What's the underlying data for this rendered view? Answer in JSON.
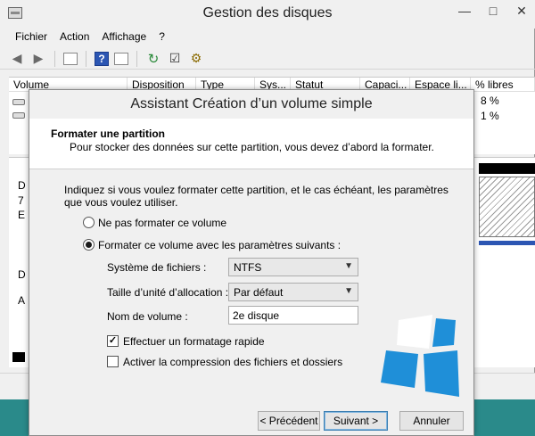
{
  "bg": {
    "title": "Gestion des disques",
    "menu": [
      "Fichier",
      "Action",
      "Affichage",
      "?"
    ],
    "columns": [
      "Volume",
      "Disposition",
      "Type",
      "Sys...",
      "Statut",
      "Capaci...",
      "Espace li...",
      "% libres"
    ],
    "pct_row1": "8 %",
    "pct_row2": "1 %",
    "left_letters": [
      "D",
      "7",
      "E",
      "D",
      "A"
    ]
  },
  "wizard": {
    "title": "Assistant Création d’un volume simple",
    "header_title": "Formater une partition",
    "header_subtitle": "Pour stocker des données sur cette partition, vous devez d’abord la formater.",
    "intro": "Indiquez si vous voulez formater cette partition, et le cas échéant, les paramètres que vous voulez utiliser.",
    "option_no_format": "Ne pas formater ce volume",
    "option_format": "Formater ce volume avec les paramètres suivants :",
    "option_selected": "format",
    "fs_label": "Système de fichiers :",
    "fs_value": "NTFS",
    "alloc_label": "Taille d’unité d’allocation :",
    "alloc_value": "Par défaut",
    "volname_label": "Nom de volume :",
    "volname_value": "2e disque",
    "quick_format_label": "Effectuer un formatage rapide",
    "quick_format_checked": true,
    "compression_label": "Activer la compression des fichiers et dossiers",
    "compression_checked": false,
    "btn_prev": "< Précédent",
    "btn_next": "Suivant >",
    "btn_cancel": "Annuler"
  },
  "colors": {
    "accent": "#2c56b3",
    "watermark_blue": "#1f8fd8",
    "taskbar": "#2a8a8a"
  }
}
